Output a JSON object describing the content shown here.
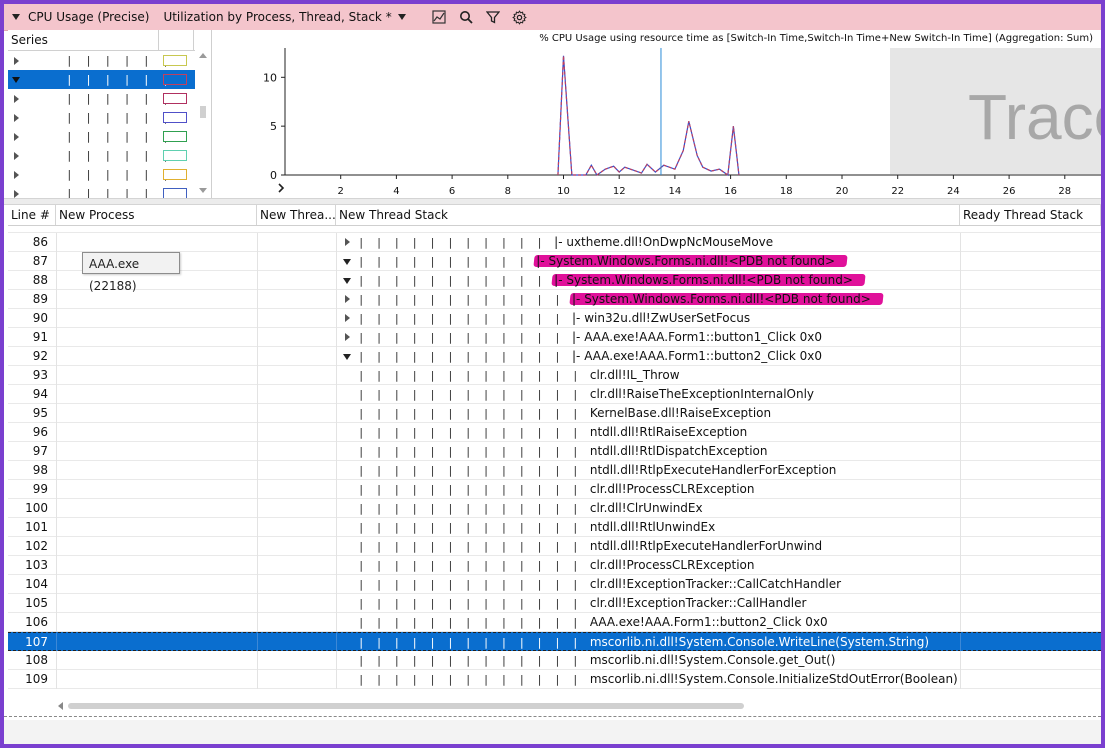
{
  "titlebar": {
    "graph_name": "CPU Usage (Precise)",
    "preset": "Utilization by Process, Thread, Stack *",
    "icons": [
      "chart-icon",
      "search-icon",
      "filter-icon",
      "gear-icon"
    ]
  },
  "series": {
    "header": "Series",
    "rows": [
      {
        "expanded": false,
        "selected": false,
        "color": "#c8c850"
      },
      {
        "expanded": true,
        "selected": true,
        "color": "#3b3bd0"
      },
      {
        "expanded": false,
        "selected": false,
        "color": "#b03060"
      },
      {
        "expanded": false,
        "selected": false,
        "color": "#5050c8"
      },
      {
        "expanded": false,
        "selected": false,
        "color": "#30a050"
      },
      {
        "expanded": false,
        "selected": false,
        "color": "#60d0b0"
      },
      {
        "expanded": false,
        "selected": false,
        "color": "#e0b030"
      },
      {
        "expanded": false,
        "selected": false,
        "color": "#4060c0"
      }
    ]
  },
  "chart_data": {
    "type": "line",
    "title": "% CPU Usage using resource time as [Switch-In Time,Switch-In Time+New Switch-In Time] (Aggregation: Sum)",
    "xlim": [
      0,
      29.3
    ],
    "ylim": [
      0,
      13
    ],
    "xticks": [
      2,
      4,
      6,
      8,
      10,
      12,
      14,
      16,
      18,
      20,
      22,
      24,
      26,
      28
    ],
    "yticks": [
      0,
      5,
      10
    ],
    "cursor_x": 13.5,
    "overlay_text": "Trace",
    "series": [
      {
        "color": "#c04060",
        "x": [
          9.8,
          10.0,
          10.3,
          10.8,
          11.0,
          11.2,
          11.5,
          11.8,
          12.0,
          12.2,
          12.5,
          12.8,
          13.0,
          13.3,
          13.6,
          14.0,
          14.3,
          14.5,
          14.8,
          15.0,
          15.3,
          15.6,
          15.9,
          16.1,
          16.3
        ],
        "y": [
          0,
          12.2,
          0,
          0,
          1.0,
          0,
          0.6,
          0.9,
          0.3,
          0.8,
          0.5,
          0.2,
          1.1,
          0.3,
          1.0,
          0.6,
          2.5,
          5.5,
          2.0,
          0.8,
          0.4,
          0.6,
          0,
          5.0,
          0
        ]
      }
    ]
  },
  "grid": {
    "columns": [
      {
        "name": "line",
        "label": "Line #"
      },
      {
        "name": "new-process",
        "label": "New Process"
      },
      {
        "name": "new-thread",
        "label": "New Threa..."
      },
      {
        "name": "new-thread-stack",
        "label": "New Thread Stack"
      },
      {
        "name": "ready-thread-stack",
        "label": "Ready Thread Stack"
      }
    ],
    "rows": [
      {
        "line": "86",
        "indent": 12,
        "exp": "right",
        "text": "|- uxtheme.dll!OnDwpNcMouseMove"
      },
      {
        "line": "87",
        "indent": 11,
        "exp": "down",
        "text": "|- System.Windows.Forms.ni.dll!<PDB not found>",
        "hl": true
      },
      {
        "line": "88",
        "indent": 12,
        "exp": "down",
        "text": "|- System.Windows.Forms.ni.dll!<PDB not found>",
        "hl": true
      },
      {
        "line": "89",
        "indent": 13,
        "exp": "right",
        "text": "|- System.Windows.Forms.ni.dll!<PDB not found>",
        "hl": true
      },
      {
        "line": "90",
        "indent": 13,
        "exp": "right",
        "text": "|- win32u.dll!ZwUserSetFocus"
      },
      {
        "line": "91",
        "indent": 13,
        "exp": "right",
        "text": "|- AAA.exe!AAA.Form1::button1_Click 0x0"
      },
      {
        "line": "92",
        "indent": 13,
        "exp": "down",
        "text": "|- AAA.exe!AAA.Form1::button2_Click 0x0"
      },
      {
        "line": "93",
        "indent": 14,
        "exp": "",
        "text": "clr.dll!IL_Throw"
      },
      {
        "line": "94",
        "indent": 14,
        "exp": "",
        "text": "clr.dll!RaiseTheExceptionInternalOnly"
      },
      {
        "line": "95",
        "indent": 14,
        "exp": "",
        "text": "KernelBase.dll!RaiseException"
      },
      {
        "line": "96",
        "indent": 14,
        "exp": "",
        "text": "ntdll.dll!RtlRaiseException"
      },
      {
        "line": "97",
        "indent": 14,
        "exp": "",
        "text": "ntdll.dll!RtlDispatchException"
      },
      {
        "line": "98",
        "indent": 14,
        "exp": "",
        "text": "ntdll.dll!RtlpExecuteHandlerForException"
      },
      {
        "line": "99",
        "indent": 14,
        "exp": "",
        "text": "clr.dll!ProcessCLRException"
      },
      {
        "line": "100",
        "indent": 14,
        "exp": "",
        "text": "clr.dll!ClrUnwindEx"
      },
      {
        "line": "101",
        "indent": 14,
        "exp": "",
        "text": "ntdll.dll!RtlUnwindEx"
      },
      {
        "line": "102",
        "indent": 14,
        "exp": "",
        "text": "ntdll.dll!RtlpExecuteHandlerForUnwind"
      },
      {
        "line": "103",
        "indent": 14,
        "exp": "",
        "text": "clr.dll!ProcessCLRException"
      },
      {
        "line": "104",
        "indent": 14,
        "exp": "",
        "text": "clr.dll!ExceptionTracker::CallCatchHandler"
      },
      {
        "line": "105",
        "indent": 14,
        "exp": "",
        "text": "clr.dll!ExceptionTracker::CallHandler"
      },
      {
        "line": "106",
        "indent": 14,
        "exp": "",
        "text": "AAA.exe!AAA.Form1::button2_Click 0x0"
      },
      {
        "line": "107",
        "indent": 14,
        "exp": "",
        "text": "mscorlib.ni.dll!System.Console.WriteLine(System.String)",
        "selected": true
      },
      {
        "line": "108",
        "indent": 14,
        "exp": "",
        "text": "mscorlib.ni.dll!System.Console.get_Out()"
      },
      {
        "line": "109",
        "indent": 14,
        "exp": "",
        "text": "mscorlib.ni.dll!System.Console.InitializeStdOutError(Boolean)"
      }
    ]
  },
  "tooltip": {
    "text": "AAA.exe (22188)"
  }
}
